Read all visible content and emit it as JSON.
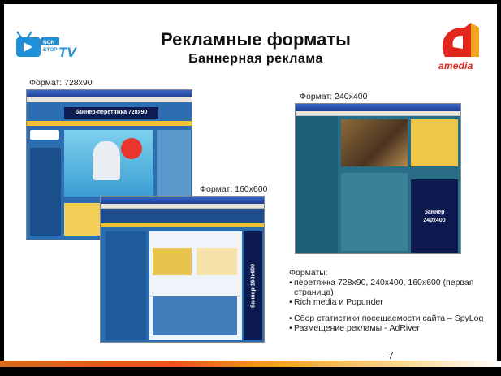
{
  "slide": {
    "title": "Рекламные форматы",
    "subtitle": "Баннерная реклама",
    "page_number": "7"
  },
  "logos": {
    "left_logo_text": "NON STOP TV",
    "right_logo_text": "AMEDIA"
  },
  "captions": {
    "fmt_728": "Формат: 728х90",
    "fmt_240": "Формат: 240х400",
    "fmt_160": "Формат: 160х600"
  },
  "screens": {
    "shot1_banner": "баннер-перетяжка 728х90",
    "shot2_banner": "баннер 160х600",
    "shot3_banner": "баннер\n240х400"
  },
  "features": {
    "title": "Форматы:",
    "items": [
      "перетяжка 728х90, 240х400, 160х600 (первая страница)",
      "Rich media и Popunder",
      "Сбор статистики посещаемости сайта – SpyLog",
      "Размещение рекламы - AdRiver"
    ]
  },
  "colors": {
    "bottom_stripe_start": "#d86a1a",
    "bottom_stripe_end": "#ffffff",
    "amedia_red": "#e2261d",
    "banner_navy": "#0c1a4f"
  }
}
